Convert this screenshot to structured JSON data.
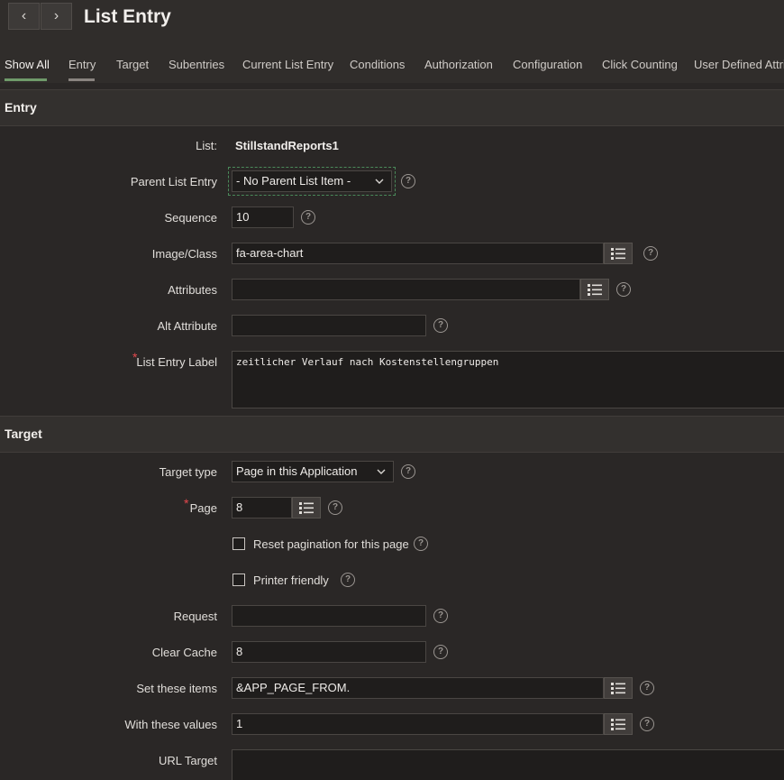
{
  "header": {
    "title": "List Entry",
    "back_icon": "‹",
    "forward_icon": "›"
  },
  "tabs": [
    {
      "label": "Show All"
    },
    {
      "label": "Entry"
    },
    {
      "label": "Target"
    },
    {
      "label": "Subentries"
    },
    {
      "label": "Current List Entry"
    },
    {
      "label": "Conditions"
    },
    {
      "label": "Authorization"
    },
    {
      "label": "Configuration"
    },
    {
      "label": "Click Counting"
    },
    {
      "label": "User Defined Attrib"
    }
  ],
  "entry": {
    "section_title": "Entry",
    "list_label": "List:",
    "list_value": "StillstandReports1",
    "parent_label": "Parent List Entry",
    "parent_value": "- No Parent List Item -",
    "sequence_label": "Sequence",
    "sequence_value": "10",
    "image_label": "Image/Class",
    "image_value": "fa-area-chart",
    "attributes_label": "Attributes",
    "attributes_value": "",
    "alt_label": "Alt Attribute",
    "alt_value": "",
    "entry_label_label": "List Entry Label",
    "entry_label_value": "zeitlicher Verlauf nach Kostenstellengruppen"
  },
  "target": {
    "section_title": "Target",
    "type_label": "Target type",
    "type_value": "Page in this Application",
    "page_label": "Page",
    "page_value": "8",
    "reset_label": "Reset pagination for this page",
    "printer_label": "Printer friendly",
    "request_label": "Request",
    "request_value": "",
    "clear_cache_label": "Clear Cache",
    "clear_cache_value": "8",
    "set_items_label": "Set these items",
    "set_items_value": "&APP_PAGE_FROM.",
    "with_values_label": "With these values",
    "with_values_value": "1",
    "url_target_label": "URL Target",
    "url_target_value": ""
  },
  "help_glyph": "?",
  "required_marker": "*",
  "colors": {
    "background": "#2a2726",
    "tab_active_underline": "#6f9a6a",
    "tab_underline": "#8a8480",
    "focus_outline": "#4a8a5a"
  }
}
